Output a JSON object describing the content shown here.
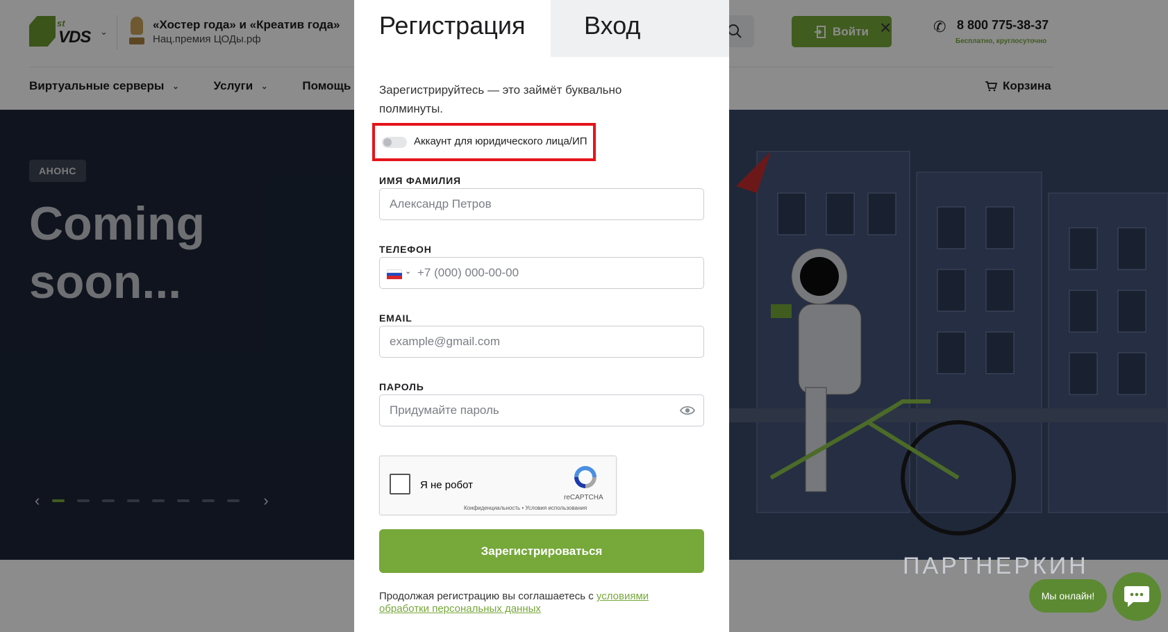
{
  "header": {
    "logo_st": "st",
    "logo_vds": "VDS",
    "award_title": "«Хостер года» и «Креатив года»",
    "award_sub": "Нац.премия ЦОДы.рф",
    "login_label": "Войти",
    "phone": "8 800 775-38-37",
    "phone_sub": "Бесплатно, круглосуточно"
  },
  "nav": {
    "items": [
      "Виртуальные серверы",
      "Услуги",
      "Помощь"
    ],
    "cart": "Корзина"
  },
  "hero": {
    "badge": "АНОНС",
    "title": "Coming soon...",
    "slides_count": 8,
    "active_slide": 1
  },
  "modal": {
    "tab_register": "Регистрация",
    "tab_login": "Вход",
    "close": "×",
    "intro": "Зарегистрируйтесь — это займёт буквально полминуты.",
    "legal_toggle_label": "Аккаунт для юридического лица/ИП",
    "legal_toggle_on": false,
    "name_label": "ИМЯ ФАМИЛИЯ",
    "name_placeholder": "Александр Петров",
    "phone_label": "ТЕЛЕФОН",
    "phone_placeholder": "+7 (000) 000-00-00",
    "email_label": "EMAIL",
    "email_placeholder": "example@gmail.com",
    "password_label": "ПАРОЛЬ",
    "password_placeholder": "Придумайте пароль",
    "captcha_label": "Я не робот",
    "captcha_brand": "reCAPTCHA",
    "captcha_links": "Конфиденциальность • Условия использования",
    "submit_label": "Зарегистрироваться",
    "terms_text": "Продолжая регистрацию вы соглашаетесь с ",
    "terms_link": "условиями обработки персональных данных"
  },
  "widgets": {
    "online_label": "Мы онлайн!",
    "watermark": "ПАРТНЕРКИН"
  },
  "colors": {
    "accent": "#76a83a",
    "highlight_box": "#e5141a",
    "hero_bg": "#1c2638"
  }
}
